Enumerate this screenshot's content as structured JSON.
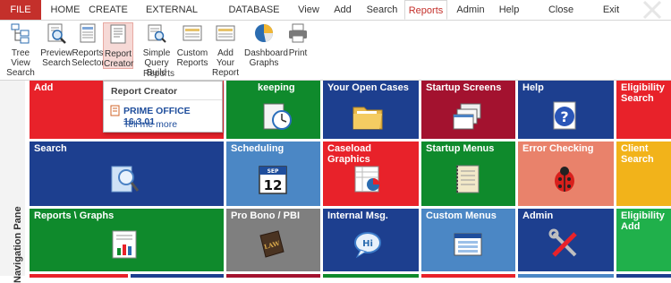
{
  "menu": {
    "file": "FILE",
    "tabs": [
      "HOME",
      "CREATE",
      "EXTERNAL DATA",
      "DATABASE TOOLS",
      "View",
      "Add",
      "Search",
      "Reports",
      "Admin",
      "Help",
      "Close Preview",
      "Exit"
    ],
    "active_tab": "Reports"
  },
  "ribbon": {
    "buttons": [
      {
        "line1": "Tree View",
        "line2": "Search",
        "icon": "tree-view-icon"
      },
      {
        "line1": "Preview",
        "line2": "Search",
        "icon": "preview-search-icon"
      },
      {
        "line1": "Reports",
        "line2": "Selector",
        "icon": "reports-selector-icon"
      },
      {
        "line1": "Report",
        "line2": "Creator",
        "icon": "report-creator-icon"
      },
      {
        "line1": "Simple",
        "line2": "Query Build",
        "icon": "query-build-icon"
      },
      {
        "line1": "Custom",
        "line2": "Reports",
        "icon": "custom-reports-icon"
      },
      {
        "line1": "Add Your",
        "line2": "Report",
        "icon": "add-report-icon"
      },
      {
        "line1": "Dashboard",
        "line2": "Graphs",
        "icon": "pie-chart-icon"
      },
      {
        "line1": "Print",
        "line2": "",
        "icon": "printer-icon"
      }
    ],
    "group_label": "Reports"
  },
  "nav_pane": {
    "label": "Navigation Pane"
  },
  "tooltip": {
    "title": "Report Creator",
    "app": "PRIME OFFICE 16.3.01",
    "more": "Tell me more"
  },
  "tiles": {
    "add": "Add",
    "bookkeeping": "keeping",
    "open_cases": "Your Open Cases",
    "startup_screens": "Startup Screens",
    "help": "Help",
    "eligibility_search": "Eligibility Search",
    "search": "Search",
    "scheduling": "Scheduling",
    "caseload_graphics": "Caseload Graphics",
    "startup_menus": "Startup Menus",
    "error_checking": "Error Checking",
    "client_search": "Client Search",
    "reports_graphs": "Reports \\ Graphs",
    "pro_bono": "Pro Bono / PBI",
    "internal_msg": "Internal Msg.",
    "custom_menus": "Custom Menus",
    "admin": "Admin",
    "eligibility_add": "Eligibility Add",
    "calendar_day": "12",
    "calendar_month": "SEP"
  },
  "colors": {
    "red": "#e8222a",
    "green": "#0f8a2c",
    "blue": "#1d3f8f",
    "maroon": "#a3122f",
    "accent": "#c4302b"
  }
}
